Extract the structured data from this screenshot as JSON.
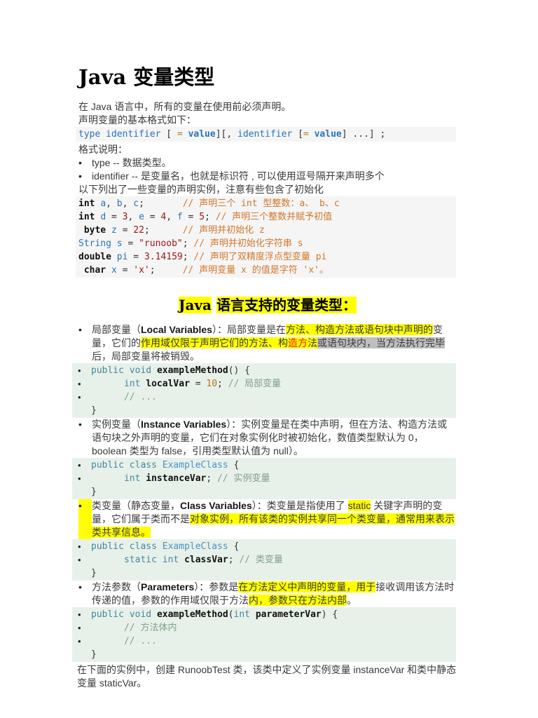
{
  "ui": {
    "bullet": "•"
  },
  "colors": {
    "highlight_yellow": "#ffff00",
    "highlight_gray": "#bfbfbf",
    "highlight_red_text": "#ee1111",
    "code_block_gray_bg": "#f5f5f5",
    "code_block_green_bg": "#e7f1ea",
    "code_identifier_blue": "#2973b7",
    "code_literal_red": "#a31515",
    "code_comment_orange": "#d2772b",
    "code_keyword_teal": "#44879c",
    "code_class_blue": "#4a92c4",
    "code_number_orange": "#b9731f",
    "code_comment_green": "#82a08a",
    "code_operator_olive": "#9a8a00",
    "body_text": "#3a3a3a"
  },
  "title": "Java 变量类型",
  "intro": {
    "line1": "在 Java 语言中，所有的变量在使用前必须声明。",
    "line2": "声明变量的基本格式如下："
  },
  "syntax_block": {
    "segments": [
      {
        "c": "id",
        "t": "type"
      },
      {
        "t": " "
      },
      {
        "c": "id",
        "t": "identifier"
      },
      {
        "t": " [ "
      },
      {
        "c": "op",
        "t": "="
      },
      {
        "t": " "
      },
      {
        "c": "idb",
        "t": "value"
      },
      {
        "t": "][, "
      },
      {
        "c": "id",
        "t": "identifier"
      },
      {
        "t": " ["
      },
      {
        "c": "op",
        "t": "="
      },
      {
        "t": " "
      },
      {
        "c": "idb",
        "t": "value"
      },
      {
        "t": "] ...] ;"
      }
    ]
  },
  "format_note": "格式说明：",
  "explain_list": [
    {
      "segments": [
        {
          "t": "type -- 数据类型。"
        }
      ]
    },
    {
      "segments": [
        {
          "t": "identifier -- 是变量名，也就是标识符 , 可以使用逗号隔开来声明多个"
        }
      ]
    }
  ],
  "examples_note": "以下列出了一些变量的声明实例，注意有些包含了初始化",
  "declare_block": {
    "lines": [
      {
        "segments": [
          {
            "c": "kb",
            "t": "int"
          },
          {
            "t": " "
          },
          {
            "c": "id",
            "t": "a"
          },
          {
            "t": ", "
          },
          {
            "c": "id",
            "t": "b"
          },
          {
            "t": ", "
          },
          {
            "c": "id",
            "t": "c"
          },
          {
            "t": ";       "
          },
          {
            "c": "cm",
            "t": "// 声明三个 int 型整数：a、 b、c"
          }
        ]
      },
      {
        "segments": [
          {
            "c": "kb",
            "t": "int"
          },
          {
            "t": " "
          },
          {
            "c": "id",
            "t": "d"
          },
          {
            "t": " = "
          },
          {
            "c": "nm",
            "t": "3"
          },
          {
            "t": ", "
          },
          {
            "c": "id",
            "t": "e"
          },
          {
            "t": " = "
          },
          {
            "c": "nm",
            "t": "4"
          },
          {
            "t": ", "
          },
          {
            "c": "id",
            "t": "f"
          },
          {
            "t": " = "
          },
          {
            "c": "nm",
            "t": "5"
          },
          {
            "t": "; "
          },
          {
            "c": "cm",
            "t": "// 声明三个整数并赋予初值"
          }
        ]
      },
      {
        "segments": [
          {
            "t": " "
          },
          {
            "c": "kb",
            "t": "byte"
          },
          {
            "t": " "
          },
          {
            "c": "id",
            "t": "z"
          },
          {
            "t": " = "
          },
          {
            "c": "nm",
            "t": "22"
          },
          {
            "t": ";      "
          },
          {
            "c": "cm",
            "t": "// 声明并初始化 z"
          }
        ]
      },
      {
        "segments": [
          {
            "c": "id",
            "t": "String"
          },
          {
            "t": " "
          },
          {
            "c": "id",
            "t": "s"
          },
          {
            "t": " = "
          },
          {
            "c": "st",
            "t": "\"runoob\""
          },
          {
            "t": "; "
          },
          {
            "c": "cm",
            "t": "// 声明并初始化字符串 s"
          }
        ]
      },
      {
        "segments": [
          {
            "c": "kb",
            "t": "double"
          },
          {
            "t": " "
          },
          {
            "c": "id",
            "t": "pi"
          },
          {
            "t": " = "
          },
          {
            "c": "nm",
            "t": "3.14159"
          },
          {
            "t": "; "
          },
          {
            "c": "cm",
            "t": "// 声明了双精度浮点型变量 pi"
          }
        ]
      },
      {
        "segments": [
          {
            "t": " "
          },
          {
            "c": "kb",
            "t": "char"
          },
          {
            "t": " "
          },
          {
            "c": "id",
            "t": "x"
          },
          {
            "t": " = "
          },
          {
            "c": "st",
            "t": "'x'"
          },
          {
            "t": ";     "
          },
          {
            "c": "cm",
            "t": "// 声明变量 x 的值是字符 'x'。"
          }
        ]
      }
    ]
  },
  "heading": {
    "segments": [
      {
        "c": "hlb",
        "t": "Java"
      },
      {
        "t": " "
      },
      {
        "c": "hlb",
        "t": "语言支持的变量类型："
      }
    ]
  },
  "var_types": [
    {
      "name": "local-variables",
      "segments": [
        {
          "t": "局部变量（"
        },
        {
          "c": "b",
          "t": "Local Variables"
        },
        {
          "t": "）：局部变量是在"
        },
        {
          "c": "hl",
          "t": "方法"
        },
        {
          "c": "hl",
          "t": "、构造方法或语句块中声明的"
        },
        {
          "t": "变量，它们的"
        },
        {
          "c": "hl",
          "t": "作用域仅限于声明它们的方法、构"
        },
        {
          "c": "hlr",
          "t": "造方"
        },
        {
          "c": "hl",
          "t": "法"
        },
        {
          "c": "sel",
          "t": "或语句块内，当方法执行完毕"
        },
        {
          "t": "后，局部变量将被销毁。"
        }
      ],
      "code": [
        {
          "bullet": true,
          "segments": [
            {
              "c": "kw",
              "t": "public"
            },
            {
              "t": " "
            },
            {
              "c": "kw",
              "t": "void"
            },
            {
              "t": " "
            },
            {
              "c": "fn",
              "t": "exampleMethod"
            },
            {
              "t": "() {"
            }
          ]
        },
        {
          "bullet": true,
          "segments": [
            {
              "t": "      "
            },
            {
              "c": "kw",
              "t": "int"
            },
            {
              "t": " "
            },
            {
              "c": "fn",
              "t": "localVar"
            },
            {
              "t": " = "
            },
            {
              "c": "nm2",
              "t": "10"
            },
            {
              "t": "; "
            },
            {
              "c": "cm2",
              "t": "// 局部变量"
            }
          ]
        },
        {
          "bullet": true,
          "segments": [
            {
              "t": "      "
            },
            {
              "c": "cm2",
              "t": "// ..."
            }
          ]
        },
        {
          "bullet": false,
          "segments": [
            {
              "t": "}"
            }
          ]
        }
      ]
    },
    {
      "name": "instance-variables",
      "segments": [
        {
          "t": "实例变量（"
        },
        {
          "c": "b",
          "t": "Instance Variables"
        },
        {
          "t": "）：实例变量是在类中声明，但在方法、构造方法或语句块之外声明的变量，它们在对象实例化时被初始化，数值类型默认为 0，boolean 类型为 false，引用类型默认值为 null）。"
        }
      ],
      "code": [
        {
          "bullet": true,
          "segments": [
            {
              "c": "kw",
              "t": "public"
            },
            {
              "t": " "
            },
            {
              "c": "kw",
              "t": "class"
            },
            {
              "t": " "
            },
            {
              "c": "ty",
              "t": "ExampleClass"
            },
            {
              "t": " {"
            }
          ]
        },
        {
          "bullet": true,
          "segments": [
            {
              "t": "      "
            },
            {
              "c": "kw",
              "t": "int"
            },
            {
              "t": " "
            },
            {
              "c": "fn",
              "t": "instanceVar"
            },
            {
              "t": "; "
            },
            {
              "c": "cm2",
              "t": "// 实例变量"
            }
          ]
        },
        {
          "bullet": false,
          "segments": [
            {
              "t": "}"
            }
          ]
        }
      ]
    },
    {
      "name": "class-variables",
      "bullet_highlighted": true,
      "segments": [
        {
          "t": "类变量（静态变量，"
        },
        {
          "c": "b",
          "t": "Class Variables"
        },
        {
          "t": "）：类变量是指使用了 "
        },
        {
          "c": "hl",
          "t": "static"
        },
        {
          "t": " 关键字声明的变量，它们属于类而不是"
        },
        {
          "c": "hl",
          "t": "对象实例，所有该类的实例共享同一个类变量，通常用来表示类共享信息。"
        }
      ],
      "code": [
        {
          "bullet": true,
          "segments": [
            {
              "c": "kw",
              "t": "public"
            },
            {
              "t": " "
            },
            {
              "c": "kw",
              "t": "class"
            },
            {
              "t": " "
            },
            {
              "c": "ty",
              "t": "ExampleClass"
            },
            {
              "t": " {"
            }
          ]
        },
        {
          "bullet": true,
          "segments": [
            {
              "t": "      "
            },
            {
              "c": "kw",
              "t": "static"
            },
            {
              "t": " "
            },
            {
              "c": "kw",
              "t": "int"
            },
            {
              "t": " "
            },
            {
              "c": "fn",
              "t": "classVar"
            },
            {
              "t": "; "
            },
            {
              "c": "cm2",
              "t": "// 类变量"
            }
          ]
        },
        {
          "bullet": false,
          "segments": [
            {
              "t": "}"
            }
          ]
        }
      ]
    },
    {
      "name": "parameters",
      "segments": [
        {
          "t": "方法参数（"
        },
        {
          "c": "b",
          "t": "Parameters"
        },
        {
          "t": "）：参数是"
        },
        {
          "c": "hl",
          "t": "在方法定义中声明的变量，用于"
        },
        {
          "t": "接收调用该方法时传递的值，参数的作用域仅限于方法"
        },
        {
          "c": "hl",
          "t": "内，参数只在方法内部"
        },
        {
          "t": "。"
        }
      ],
      "code": [
        {
          "bullet": true,
          "segments": [
            {
              "c": "kw",
              "t": "public"
            },
            {
              "t": " "
            },
            {
              "c": "kw",
              "t": "void"
            },
            {
              "t": " "
            },
            {
              "c": "fn",
              "t": "exampleMethod"
            },
            {
              "t": "("
            },
            {
              "c": "kw",
              "t": "int"
            },
            {
              "t": " "
            },
            {
              "c": "fn",
              "t": "parameterVar"
            },
            {
              "t": ") {"
            }
          ]
        },
        {
          "bullet": true,
          "segments": [
            {
              "t": "      "
            },
            {
              "c": "cm2",
              "t": "// 方法体内"
            }
          ]
        },
        {
          "bullet": true,
          "segments": [
            {
              "t": "      "
            },
            {
              "c": "cm2",
              "t": "// ..."
            }
          ]
        },
        {
          "bullet": false,
          "segments": [
            {
              "t": "}"
            }
          ]
        }
      ]
    }
  ],
  "closing_note": "在下面的实例中，创建 RunoobTest 类，该类中定义了实例变量 instanceVar 和类中静态变量 staticVar。"
}
